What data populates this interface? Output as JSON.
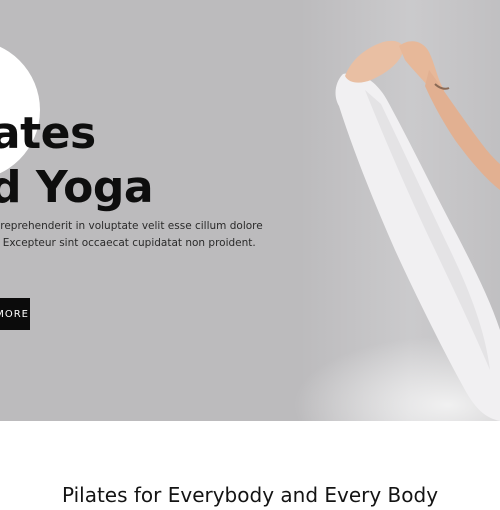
{
  "hero": {
    "title_line1": "Pilates",
    "title_line2": "and Yoga",
    "text_line1": "Duis aute irure dolor in reprehenderit in voluptate velit esse cillum dolore",
    "text_line2": "eu fugiat nulla pariatur. Excepteur sint occaecat cupidatat non proident.",
    "button_label": "MORE"
  },
  "section": {
    "title": "Pilates for Everybody and Every Body"
  },
  "colors": {
    "hero_background": "#bcbbbd",
    "button_background": "#0b0b0b",
    "title_text": "#0e0e0e"
  }
}
